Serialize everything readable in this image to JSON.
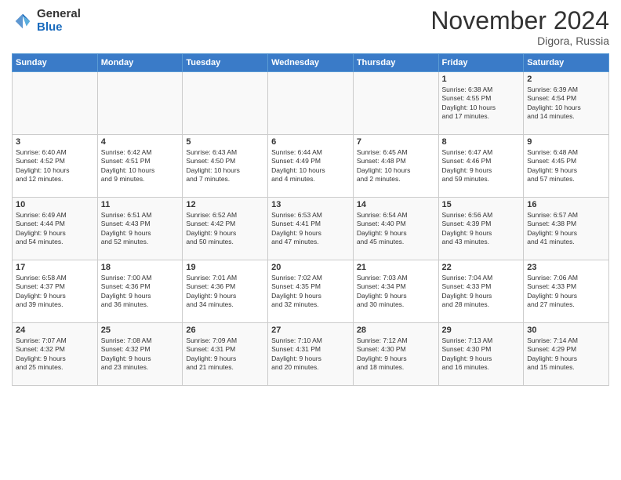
{
  "logo": {
    "general": "General",
    "blue": "Blue"
  },
  "title": "November 2024",
  "location": "Digora, Russia",
  "days_header": [
    "Sunday",
    "Monday",
    "Tuesday",
    "Wednesday",
    "Thursday",
    "Friday",
    "Saturday"
  ],
  "weeks": [
    [
      {
        "day": "",
        "info": ""
      },
      {
        "day": "",
        "info": ""
      },
      {
        "day": "",
        "info": ""
      },
      {
        "day": "",
        "info": ""
      },
      {
        "day": "",
        "info": ""
      },
      {
        "day": "1",
        "info": "Sunrise: 6:38 AM\nSunset: 4:55 PM\nDaylight: 10 hours\nand 17 minutes."
      },
      {
        "day": "2",
        "info": "Sunrise: 6:39 AM\nSunset: 4:54 PM\nDaylight: 10 hours\nand 14 minutes."
      }
    ],
    [
      {
        "day": "3",
        "info": "Sunrise: 6:40 AM\nSunset: 4:52 PM\nDaylight: 10 hours\nand 12 minutes."
      },
      {
        "day": "4",
        "info": "Sunrise: 6:42 AM\nSunset: 4:51 PM\nDaylight: 10 hours\nand 9 minutes."
      },
      {
        "day": "5",
        "info": "Sunrise: 6:43 AM\nSunset: 4:50 PM\nDaylight: 10 hours\nand 7 minutes."
      },
      {
        "day": "6",
        "info": "Sunrise: 6:44 AM\nSunset: 4:49 PM\nDaylight: 10 hours\nand 4 minutes."
      },
      {
        "day": "7",
        "info": "Sunrise: 6:45 AM\nSunset: 4:48 PM\nDaylight: 10 hours\nand 2 minutes."
      },
      {
        "day": "8",
        "info": "Sunrise: 6:47 AM\nSunset: 4:46 PM\nDaylight: 9 hours\nand 59 minutes."
      },
      {
        "day": "9",
        "info": "Sunrise: 6:48 AM\nSunset: 4:45 PM\nDaylight: 9 hours\nand 57 minutes."
      }
    ],
    [
      {
        "day": "10",
        "info": "Sunrise: 6:49 AM\nSunset: 4:44 PM\nDaylight: 9 hours\nand 54 minutes."
      },
      {
        "day": "11",
        "info": "Sunrise: 6:51 AM\nSunset: 4:43 PM\nDaylight: 9 hours\nand 52 minutes."
      },
      {
        "day": "12",
        "info": "Sunrise: 6:52 AM\nSunset: 4:42 PM\nDaylight: 9 hours\nand 50 minutes."
      },
      {
        "day": "13",
        "info": "Sunrise: 6:53 AM\nSunset: 4:41 PM\nDaylight: 9 hours\nand 47 minutes."
      },
      {
        "day": "14",
        "info": "Sunrise: 6:54 AM\nSunset: 4:40 PM\nDaylight: 9 hours\nand 45 minutes."
      },
      {
        "day": "15",
        "info": "Sunrise: 6:56 AM\nSunset: 4:39 PM\nDaylight: 9 hours\nand 43 minutes."
      },
      {
        "day": "16",
        "info": "Sunrise: 6:57 AM\nSunset: 4:38 PM\nDaylight: 9 hours\nand 41 minutes."
      }
    ],
    [
      {
        "day": "17",
        "info": "Sunrise: 6:58 AM\nSunset: 4:37 PM\nDaylight: 9 hours\nand 39 minutes."
      },
      {
        "day": "18",
        "info": "Sunrise: 7:00 AM\nSunset: 4:36 PM\nDaylight: 9 hours\nand 36 minutes."
      },
      {
        "day": "19",
        "info": "Sunrise: 7:01 AM\nSunset: 4:36 PM\nDaylight: 9 hours\nand 34 minutes."
      },
      {
        "day": "20",
        "info": "Sunrise: 7:02 AM\nSunset: 4:35 PM\nDaylight: 9 hours\nand 32 minutes."
      },
      {
        "day": "21",
        "info": "Sunrise: 7:03 AM\nSunset: 4:34 PM\nDaylight: 9 hours\nand 30 minutes."
      },
      {
        "day": "22",
        "info": "Sunrise: 7:04 AM\nSunset: 4:33 PM\nDaylight: 9 hours\nand 28 minutes."
      },
      {
        "day": "23",
        "info": "Sunrise: 7:06 AM\nSunset: 4:33 PM\nDaylight: 9 hours\nand 27 minutes."
      }
    ],
    [
      {
        "day": "24",
        "info": "Sunrise: 7:07 AM\nSunset: 4:32 PM\nDaylight: 9 hours\nand 25 minutes."
      },
      {
        "day": "25",
        "info": "Sunrise: 7:08 AM\nSunset: 4:32 PM\nDaylight: 9 hours\nand 23 minutes."
      },
      {
        "day": "26",
        "info": "Sunrise: 7:09 AM\nSunset: 4:31 PM\nDaylight: 9 hours\nand 21 minutes."
      },
      {
        "day": "27",
        "info": "Sunrise: 7:10 AM\nSunset: 4:31 PM\nDaylight: 9 hours\nand 20 minutes."
      },
      {
        "day": "28",
        "info": "Sunrise: 7:12 AM\nSunset: 4:30 PM\nDaylight: 9 hours\nand 18 minutes."
      },
      {
        "day": "29",
        "info": "Sunrise: 7:13 AM\nSunset: 4:30 PM\nDaylight: 9 hours\nand 16 minutes."
      },
      {
        "day": "30",
        "info": "Sunrise: 7:14 AM\nSunset: 4:29 PM\nDaylight: 9 hours\nand 15 minutes."
      }
    ]
  ]
}
